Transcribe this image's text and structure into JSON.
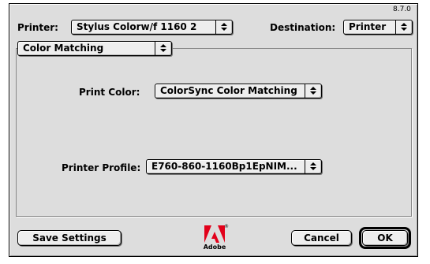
{
  "header": {
    "version": "8.7.0",
    "printer_label": "Printer:",
    "printer_value": "Stylus Colorw/f 1160 2",
    "destination_label": "Destination:",
    "destination_value": "Printer"
  },
  "panel": {
    "selected": "Color Matching"
  },
  "fields": {
    "print_color_label": "Print Color:",
    "print_color_value": "ColorSync Color Matching",
    "printer_profile_label": "Printer Profile:",
    "printer_profile_value": "E760-860-1160Bp1EpNIM..."
  },
  "footer": {
    "save_settings_label": "Save Settings",
    "logo_text": "Adobe",
    "cancel_label": "Cancel",
    "ok_label": "OK"
  },
  "icons": {
    "popup_arrows": "updown-arrows-icon",
    "logo": "adobe-logo-icon"
  },
  "colors": {
    "dialog_bg": "#dddddd",
    "adobe_red": "#e2001a"
  }
}
